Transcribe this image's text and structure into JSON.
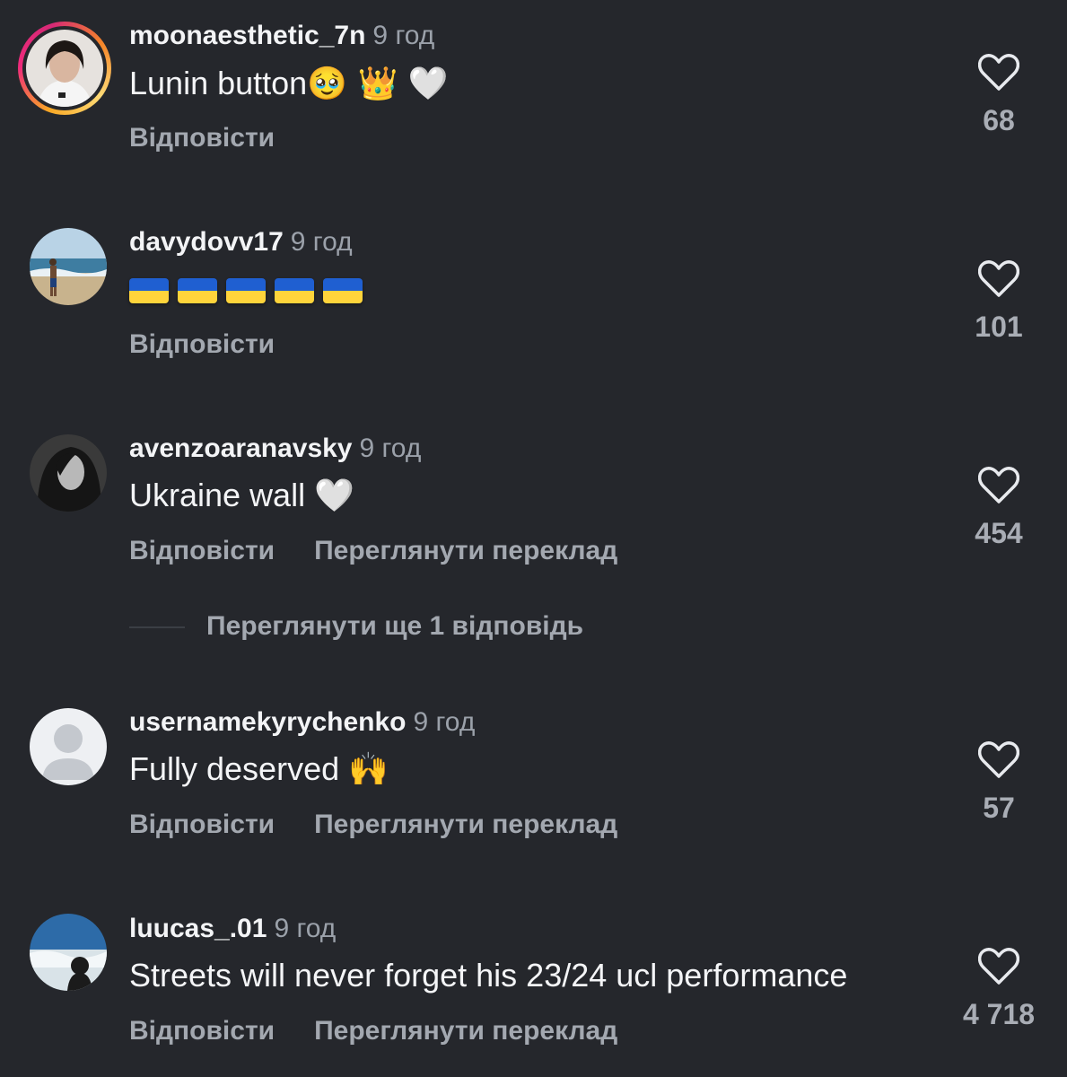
{
  "comments": [
    {
      "username": "moonaesthetic_7n",
      "time": "9 год",
      "text": "Lunin button",
      "emoji": "🥹 👑 🤍",
      "reply_label": "Відповісти",
      "likes": "68",
      "has_story": true
    },
    {
      "username": "davydovv17",
      "time": "9 год",
      "text": "",
      "emoji": "🇺🇦🇺🇦🇺🇦🇺🇦🇺🇦",
      "reply_label": "Відповісти",
      "likes": "101"
    },
    {
      "username": "avenzoaranavsky",
      "time": "9 год",
      "text": "Ukraine wall",
      "emoji": "🤍",
      "reply_label": "Відповісти",
      "translate_label": "Переглянути переклад",
      "likes": "454",
      "more_replies": "Переглянути ще 1 відповідь"
    },
    {
      "username": "usernamekyrychenko",
      "time": "9 год",
      "text": "Fully deserved",
      "emoji": "🙌",
      "reply_label": "Відповісти",
      "translate_label": "Переглянути переклад",
      "likes": "57"
    },
    {
      "username": "luucas_.01",
      "time": "9 год",
      "text": "Streets will never forget his 23/24 ucl performance",
      "reply_label": "Відповісти",
      "translate_label": "Переглянути переклад",
      "likes": "4 718"
    }
  ],
  "colors": {
    "background": "#25272c",
    "text": "#f4f5f7",
    "muted": "#a3a8b0"
  }
}
